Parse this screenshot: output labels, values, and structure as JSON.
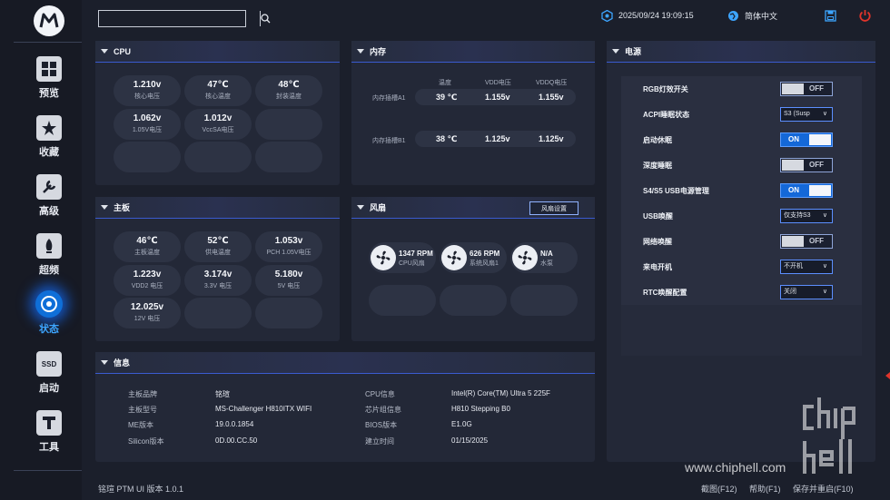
{
  "sidebar": {
    "logo": "M",
    "items": [
      {
        "label": "预览",
        "icon": "preview-icon",
        "glyph": "▦"
      },
      {
        "label": "收藏",
        "icon": "favorite-star-icon",
        "glyph": "★"
      },
      {
        "label": "高级",
        "icon": "wrench-icon",
        "glyph": "✎"
      },
      {
        "label": "超频",
        "icon": "rocket-icon",
        "glyph": "▲"
      },
      {
        "label": "状态",
        "icon": "status-icon",
        "glyph": "◉"
      },
      {
        "label": "启动",
        "icon": "ssd-icon",
        "glyph": "SSD"
      },
      {
        "label": "工具",
        "icon": "tools-icon",
        "glyph": "T"
      }
    ]
  },
  "topbar": {
    "search_placeholder": "",
    "datetime": "2025/09/24 19:09:15",
    "language": "简体中文"
  },
  "cpu": {
    "title": "CPU",
    "tiles": [
      {
        "value": "1.210v",
        "label": "核心电压"
      },
      {
        "value": "47℃",
        "label": "核心温度"
      },
      {
        "value": "48℃",
        "label": "封装温度"
      },
      {
        "value": "1.062v",
        "label": "1.05V电压"
      },
      {
        "value": "1.012v",
        "label": "VccSA电压"
      }
    ]
  },
  "memory": {
    "title": "内存",
    "headers": [
      "温度",
      "VDD电压",
      "VDDQ电压"
    ],
    "rows": [
      {
        "slot": "内存插槽A1",
        "temp": "39 ℃",
        "vdd": "1.155v",
        "vddq": "1.155v"
      },
      {
        "slot": "内存插槽B1",
        "temp": "38 ℃",
        "vdd": "1.125v",
        "vddq": "1.125v"
      }
    ]
  },
  "motherboard": {
    "title": "主板",
    "tiles": [
      {
        "value": "46℃",
        "label": "主板温度"
      },
      {
        "value": "52℃",
        "label": "供电温度"
      },
      {
        "value": "1.053v",
        "label": "PCH 1.05V电压"
      },
      {
        "value": "1.223v",
        "label": "VDD2 电压"
      },
      {
        "value": "3.174v",
        "label": "3.3V 电压"
      },
      {
        "value": "5.180v",
        "label": "5V 电压"
      },
      {
        "value": "12.025v",
        "label": "12V 电压"
      }
    ]
  },
  "fans": {
    "title": "风扇",
    "settings_button": "风扇设置",
    "items": [
      {
        "value": "1347 RPM",
        "label": "CPU风扇"
      },
      {
        "value": "626 RPM",
        "label": "系统风扇1"
      },
      {
        "value": "N/A",
        "label": "水泵"
      }
    ]
  },
  "info": {
    "title": "信息",
    "left": [
      {
        "label": "主板品牌",
        "value": "铭瑄"
      },
      {
        "label": "主板型号",
        "value": "MS-Challenger H810ITX WIFI"
      },
      {
        "label": "ME版本",
        "value": "19.0.0.1854"
      },
      {
        "label": "Silicon版本",
        "value": "0D.00.CC.50"
      }
    ],
    "right": [
      {
        "label": "CPU信息",
        "value": "Intel(R) Core(TM) Ultra 5 225F"
      },
      {
        "label": "芯片组信息",
        "value": "H810 Stepping B0"
      },
      {
        "label": "BIOS版本",
        "value": "E1.0G"
      },
      {
        "label": "建立时间",
        "value": "01/15/2025"
      }
    ]
  },
  "power": {
    "title": "电源",
    "rows": [
      {
        "label": "RGB灯效开关",
        "type": "toggle",
        "value": "OFF"
      },
      {
        "label": "ACPI睡眠状态",
        "type": "select",
        "value": "S3 (Susp"
      },
      {
        "label": "启动休眠",
        "type": "toggle",
        "value": "ON"
      },
      {
        "label": "深度睡眠",
        "type": "toggle",
        "value": "OFF"
      },
      {
        "label": "S4/S5 USB电源管理",
        "type": "toggle",
        "value": "ON"
      },
      {
        "label": "USB唤醒",
        "type": "select",
        "value": "仅支持S3"
      },
      {
        "label": "网络唤醒",
        "type": "toggle",
        "value": "OFF"
      },
      {
        "label": "来电开机",
        "type": "select",
        "value": "不开机"
      },
      {
        "label": "RTC唤醒配置",
        "type": "select",
        "value": "关闭"
      }
    ]
  },
  "footer": {
    "version": "铭瑄 PTM UI 版本 1.0.1",
    "screenshot": "截图(F12)",
    "help": "帮助(F1)",
    "save_restart": "保存并重启(F10)"
  },
  "watermark": {
    "url": "www.chiphell.com",
    "logo": "chip hell"
  },
  "colors": {
    "background": "#1b1f2b",
    "panel": "#232837",
    "accent": "#1468d8",
    "power_icon": "#e0342b"
  }
}
